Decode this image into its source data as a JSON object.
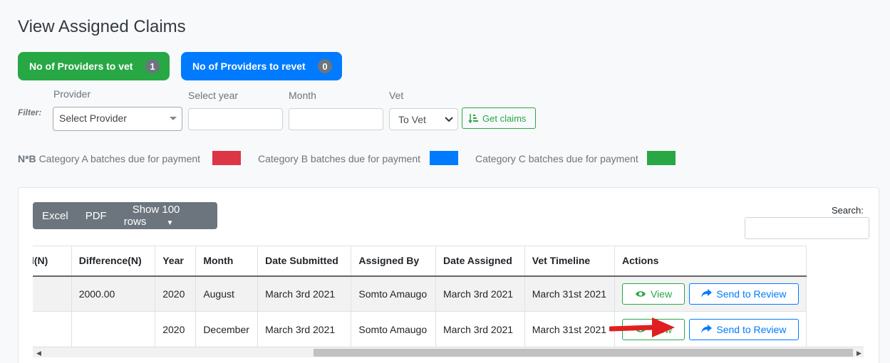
{
  "page": {
    "title": "View Assigned Claims"
  },
  "stats": {
    "to_vet_label": "No of Providers to vet",
    "to_vet_count": "1",
    "to_revet_label": "No of Providers to revet",
    "to_revet_count": "0"
  },
  "filter": {
    "label": "Filter:",
    "provider_label": "Provider",
    "provider_value": "Select Provider",
    "year_label": "Select year",
    "year_value": "",
    "month_label": "Month",
    "month_value": "",
    "vet_label": "Vet",
    "vet_value": "To Vet",
    "get_claims_label": "Get claims"
  },
  "legend": {
    "prefix": "N*B",
    "cat_a": "Category A batches due for payment",
    "cat_b": "Category B batches due for payment",
    "cat_c": "Category C batches due for payment",
    "cat_a_color": "#dc3545",
    "cat_b_color": "#007bff",
    "cat_c_color": "#28a745"
  },
  "toolbar": {
    "excel": "Excel",
    "pdf": "PDF",
    "rows": "Show 100 rows"
  },
  "search": {
    "label": "Search:",
    "value": ""
  },
  "table": {
    "headers": [
      "Processed(N)",
      "Difference(N)",
      "Year",
      "Month",
      "Date Submitted",
      "Assigned By",
      "Date Assigned",
      "Vet Timeline",
      "Actions"
    ],
    "rows": [
      [
        "",
        "2000.00",
        "2020",
        "August",
        "March 3rd 2021",
        "Somto Amaugo",
        "March 3rd 2021",
        "March 31st 2021"
      ],
      [
        "",
        "",
        "2020",
        "December",
        "March 3rd 2021",
        "Somto Amaugo",
        "March 3rd 2021",
        "March 31st 2021"
      ]
    ],
    "view_label": "View",
    "review_label": "Send to Review"
  }
}
